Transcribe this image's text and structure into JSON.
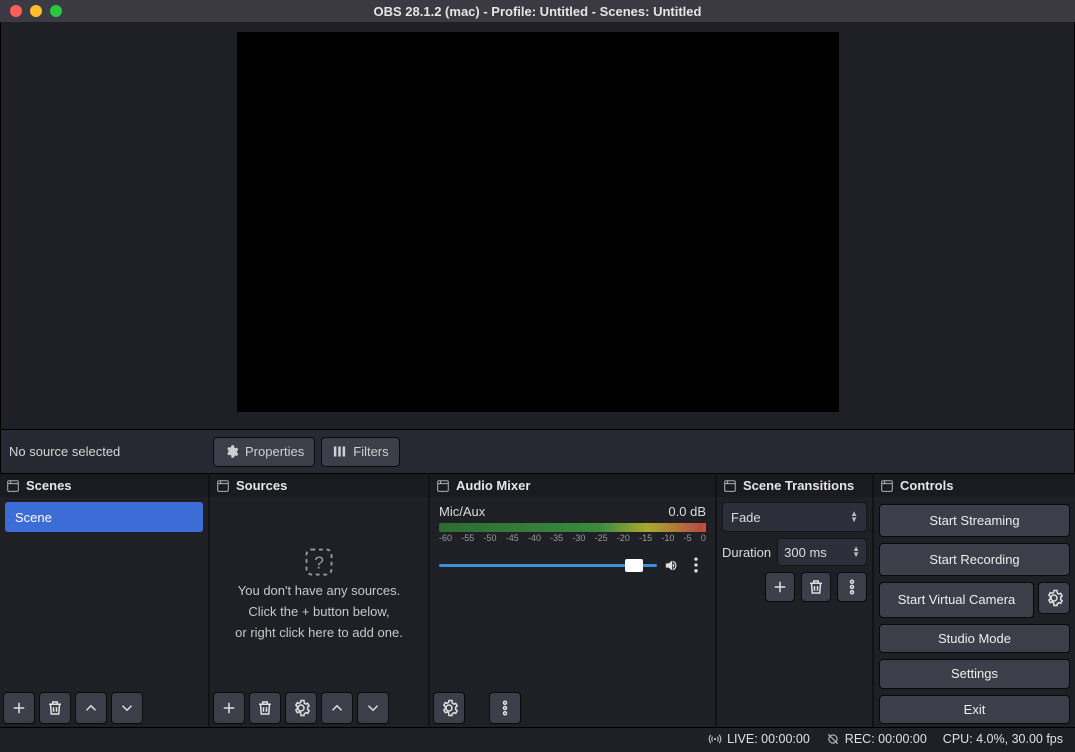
{
  "title": "OBS 28.1.2 (mac) - Profile: Untitled - Scenes: Untitled",
  "toolbar": {
    "no_source": "No source selected",
    "properties": "Properties",
    "filters": "Filters"
  },
  "panels": {
    "scenes": {
      "title": "Scenes",
      "items": [
        "Scene"
      ]
    },
    "sources": {
      "title": "Sources",
      "empty_line1": "You don't have any sources.",
      "empty_line2": "Click the + button below,",
      "empty_line3": "or right click here to add one."
    },
    "mixer": {
      "title": "Audio Mixer",
      "channel": "Mic/Aux",
      "level": "0.0 dB",
      "ticks": [
        "-60",
        "-55",
        "-50",
        "-45",
        "-40",
        "-35",
        "-30",
        "-25",
        "-20",
        "-15",
        "-10",
        "-5",
        "0"
      ]
    },
    "transitions": {
      "title": "Scene Transitions",
      "selected": "Fade",
      "duration_label": "Duration",
      "duration_value": "300 ms"
    },
    "controls": {
      "title": "Controls",
      "start_streaming": "Start Streaming",
      "start_recording": "Start Recording",
      "start_virtual_camera": "Start Virtual Camera",
      "studio_mode": "Studio Mode",
      "settings": "Settings",
      "exit": "Exit"
    }
  },
  "status": {
    "live": "LIVE: 00:00:00",
    "rec": "REC: 00:00:00",
    "cpu": "CPU: 4.0%, 30.00 fps"
  }
}
